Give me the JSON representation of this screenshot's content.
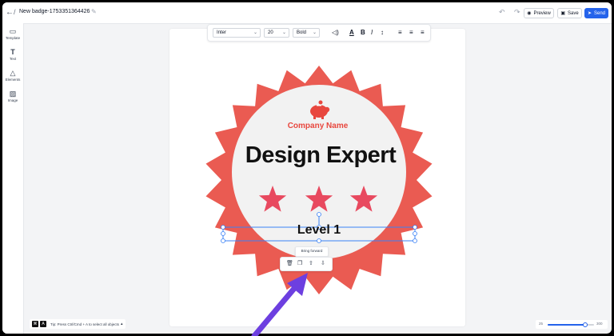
{
  "header": {
    "title": "New badge-1753351364426",
    "back_icon": "arrow-left-icon",
    "slash": "/",
    "preview_label": "Preview",
    "save_label": "Save",
    "send_label": "Send"
  },
  "sidebar": {
    "items": [
      {
        "label": "Template",
        "icon": "folder-icon"
      },
      {
        "label": "Text",
        "icon": "text-icon"
      },
      {
        "label": "Elements",
        "icon": "shapes-icon"
      },
      {
        "label": "Image",
        "icon": "image-icon"
      }
    ]
  },
  "text_toolbar": {
    "font": "Inter",
    "size": "20",
    "weight": "Bold"
  },
  "badge": {
    "company": "Company Name",
    "headline": "Design Expert",
    "level": "Level 1",
    "star_count": 3,
    "colors": {
      "outer": "#ea5b52",
      "inner": "#f2f2f2",
      "star": "#e8495f",
      "company": "#e8473e",
      "piggy": "#e8473e"
    }
  },
  "object_menu": {
    "tooltip": "Bring forward"
  },
  "footer": {
    "tip_keys": [
      "⌘",
      "A"
    ],
    "tip_text": "Tip: Press Ctrl/Cmd + A to select all objects",
    "zoom_min": "25",
    "zoom_max": "300",
    "zoom_value": 250
  },
  "colors": {
    "accent": "#2563eb",
    "selection": "#3b82f6",
    "arrow": "#6d3fe0"
  }
}
